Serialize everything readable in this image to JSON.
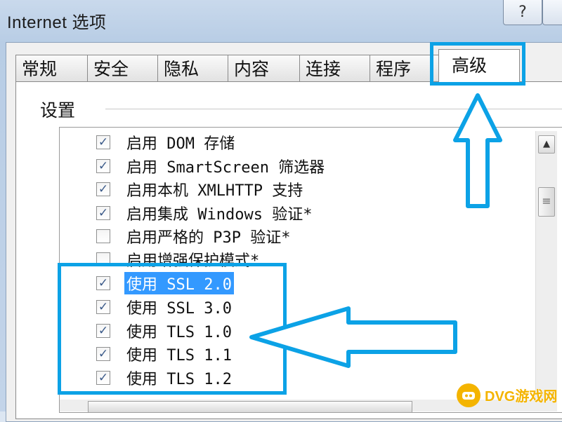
{
  "window": {
    "title": "Internet 选项",
    "help_label": "?"
  },
  "tabs": [
    {
      "label": "常规"
    },
    {
      "label": "安全"
    },
    {
      "label": "隐私"
    },
    {
      "label": "内容"
    },
    {
      "label": "连接"
    },
    {
      "label": "程序"
    },
    {
      "label": "高级",
      "active": true
    }
  ],
  "settings": {
    "group_label": "设置",
    "items": [
      {
        "label": "启用 DOM 存储",
        "checked": true
      },
      {
        "label": "启用 SmartScreen 筛选器",
        "checked": true
      },
      {
        "label": "启用本机 XMLHTTP 支持",
        "checked": true
      },
      {
        "label": "启用集成 Windows 验证*",
        "checked": true
      },
      {
        "label": "启用严格的 P3P 验证*",
        "checked": false
      },
      {
        "label": "启用增强保护模式*",
        "checked": false
      },
      {
        "label": "使用 SSL 2.0",
        "checked": true,
        "selected": true
      },
      {
        "label": "使用 SSL 3.0",
        "checked": true
      },
      {
        "label": "使用 TLS 1.0",
        "checked": true
      },
      {
        "label": "使用 TLS 1.1",
        "checked": true
      },
      {
        "label": "使用 TLS 1.2",
        "checked": true
      }
    ]
  },
  "annotations": {
    "highlight_color": "#0ca2e6"
  },
  "watermark": {
    "text": "DVG游戏网"
  },
  "icons": {
    "checkbox_check": "check-icon",
    "scroll_up": "arrow-up-icon",
    "scroll_grip": "grip-icon",
    "help": "question-icon",
    "close": "close-icon"
  }
}
